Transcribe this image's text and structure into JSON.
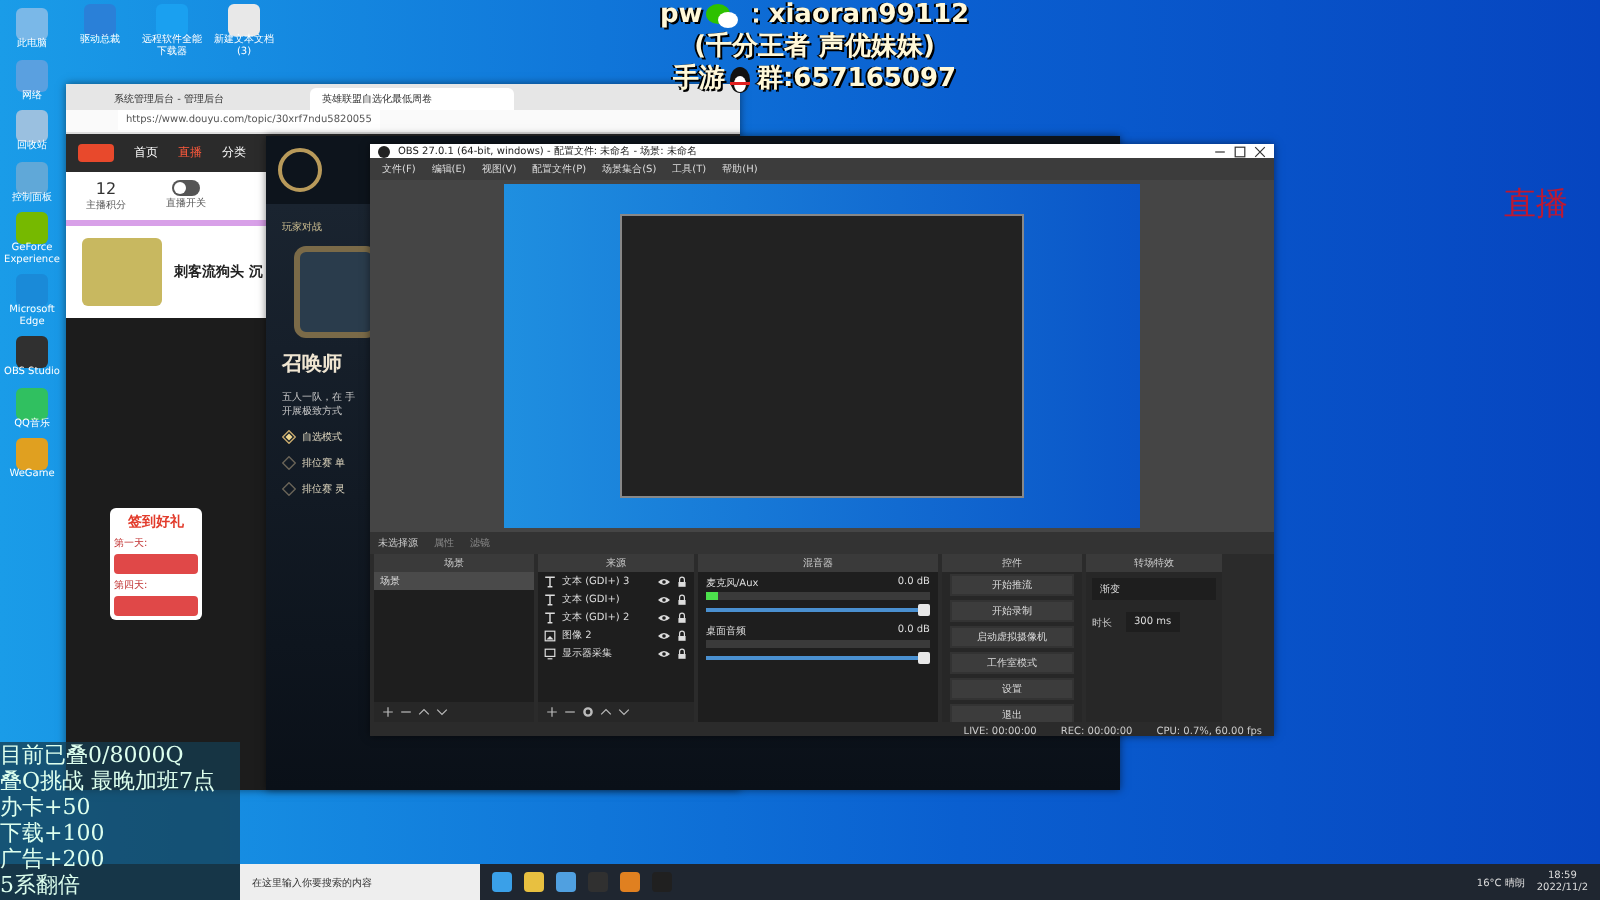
{
  "desktop_icons": [
    {
      "label": "此电脑"
    },
    {
      "label": "网络"
    },
    {
      "label": "回收站"
    },
    {
      "label": "控制面板"
    },
    {
      "label": "GeForce Experience"
    },
    {
      "label": "Microsoft Edge"
    },
    {
      "label": "OBS Studio"
    },
    {
      "label": "QQ音乐"
    },
    {
      "label": "WeGame"
    }
  ],
  "top_icons": [
    {
      "label": "驱动总裁"
    },
    {
      "label": "远程软件全能下载器"
    },
    {
      "label": "新建文本文档 (3)"
    }
  ],
  "overlay": {
    "lines": [
      {
        "before": "pw",
        "after": "：xiaoran99112"
      },
      {
        "before": "(千分王者 声优妹妹)"
      },
      {
        "before": "手游",
        "after": "群:657165097"
      }
    ],
    "badge": "直播"
  },
  "browser": {
    "tabs": [
      {
        "label": "系统管理后台 - 管理后台",
        "selected": false
      },
      {
        "label": "英雄联盟自选化最低周卷",
        "selected": true
      }
    ],
    "url": "https://www.douyu.com/topic/30xrf7ndu5820055",
    "nav": [
      "首页",
      "直播",
      "分类"
    ],
    "stats": [
      {
        "value": "12",
        "label": "主播积分"
      },
      {
        "label": "直播开关"
      }
    ],
    "streamer": "刺客流狗头 沉",
    "gift_title": "签到好礼",
    "gift_days": [
      "第一天:",
      "第四天:"
    ]
  },
  "lol": {
    "tab": "玩家对战",
    "title": "召唤师",
    "desc": "五人一队，在 手开展极致方式",
    "modes": [
      {
        "label": "自选模式",
        "selected": true
      },
      {
        "label": "排位赛 单",
        "selected": false
      },
      {
        "label": "排位赛 灵",
        "selected": false
      }
    ]
  },
  "obs": {
    "title": "OBS 27.0.1 (64-bit, windows) - 配置文件: 未命名 - 场景: 未命名",
    "menu": [
      "文件(F)",
      "编辑(E)",
      "视图(V)",
      "配置文件(P)",
      "场景集合(S)",
      "工具(T)",
      "帮助(H)"
    ],
    "no_source": "未选择源",
    "props": [
      "属性",
      "滤镜"
    ],
    "scenes": {
      "title": "场景",
      "items": [
        {
          "label": "场景",
          "selected": true
        }
      ]
    },
    "sources": {
      "title": "来源",
      "items": [
        {
          "label": "文本 (GDI+) 3",
          "kind": "text"
        },
        {
          "label": "文本 (GDI+)",
          "kind": "text"
        },
        {
          "label": "文本 (GDI+) 2",
          "kind": "text"
        },
        {
          "label": "图像 2",
          "kind": "image"
        },
        {
          "label": "显示器采集",
          "kind": "display"
        }
      ]
    },
    "mixer": {
      "title": "混音器",
      "channels": [
        {
          "name": "麦克风/Aux",
          "reading": "0.0 dB",
          "level": 0.05,
          "fader": {
            "level": 1
          }
        },
        {
          "name": "桌面音频",
          "reading": "0.0 dB",
          "fader": {
            "level": 1
          }
        }
      ]
    },
    "controls": {
      "title": "控件",
      "buttons": [
        "开始推流",
        "开始录制",
        "启动虚拟摄像机",
        "工作室模式",
        "设置",
        "退出"
      ]
    },
    "transitions": {
      "title": "转场特效",
      "value": "渐变",
      "duration_label": "时长",
      "duration": "300 ms"
    },
    "status": {
      "live": "LIVE: 00:00:00",
      "rec": "REC: 00:00:00",
      "cpu": "CPU: 0.7%, 60.00 fps"
    }
  },
  "goal_box": {
    "lines": [
      "目前已叠0/8000Q",
      "叠Q挑战 最晚加班7点",
      "办卡+50",
      "下载+100",
      "广告+200",
      "5系翻倍"
    ]
  },
  "taskbar": {
    "search": "在这里输入你要搜索的内容",
    "weather": "16°C 晴朗",
    "time": "18:59",
    "date": "2022/11/2"
  }
}
